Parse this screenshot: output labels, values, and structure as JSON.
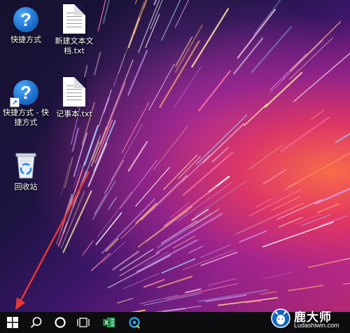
{
  "desktop": {
    "icons": [
      {
        "label": "快捷方式",
        "type": "question-shortcut"
      },
      {
        "label": "新建文本文\n档.txt",
        "type": "text-file"
      },
      {
        "label": "快捷方式 - 快\n捷方式",
        "type": "question-shortcut"
      },
      {
        "label": "记事本.txt",
        "type": "text-file"
      },
      {
        "label": "回收站",
        "type": "recycle-bin"
      }
    ]
  },
  "taskbar": {
    "items": [
      "start-windows-icon",
      "search-icon",
      "cortana-icon",
      "task-view-icon",
      "excel-icon",
      "browser-icon"
    ],
    "colors": {
      "background": "#0d0d0f",
      "excel": "#1d7a3d",
      "browser": "#2aa1e0"
    }
  },
  "annotation": {
    "arrow_color": "#e53935"
  },
  "watermark": {
    "title": "鹿大师",
    "url": "Ludashiwin.com"
  }
}
